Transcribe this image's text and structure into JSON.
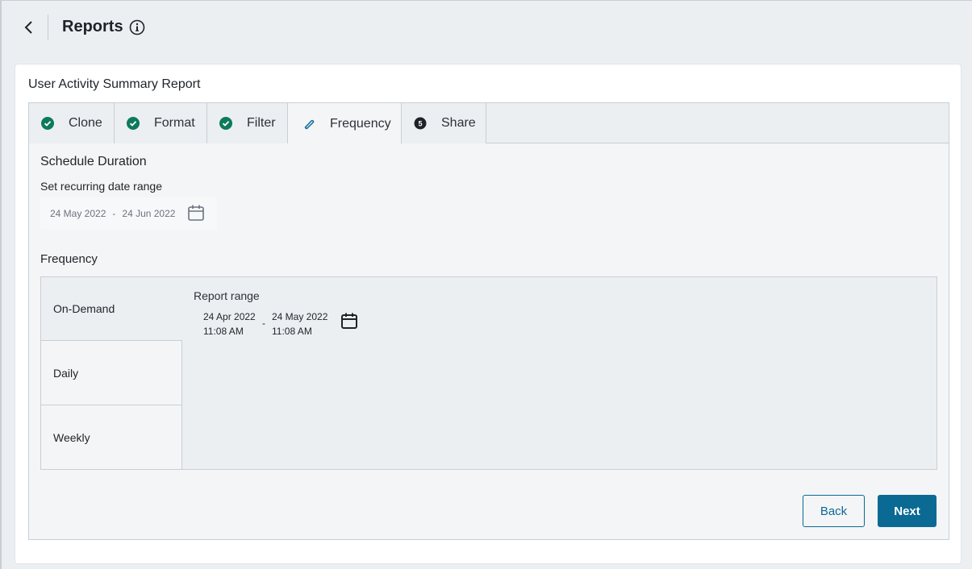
{
  "header": {
    "title": "Reports",
    "back_icon": "chevron-left-icon",
    "info_icon": "info-circle-icon"
  },
  "card": {
    "title": "User Activity Summary Report"
  },
  "tabs": [
    {
      "label": "Clone",
      "status": "complete",
      "icon": "check-circle-icon"
    },
    {
      "label": "Format",
      "status": "complete",
      "icon": "check-circle-icon"
    },
    {
      "label": "Filter",
      "status": "complete",
      "icon": "check-circle-icon"
    },
    {
      "label": "Frequency",
      "status": "active",
      "icon": "pencil-icon"
    },
    {
      "label": "Share",
      "status": "pending",
      "icon": "step-number-icon",
      "step": "5"
    }
  ],
  "schedule": {
    "title": "Schedule Duration",
    "date_range_label": "Set recurring date range",
    "start_date": "24 May 2022",
    "separator": "-",
    "end_date": "24 Jun 2022"
  },
  "frequency": {
    "title": "Frequency",
    "options": [
      "On-Demand",
      "Daily",
      "Weekly"
    ],
    "selected": "On-Demand",
    "report_range": {
      "label": "Report range",
      "from_date": "24 Apr 2022",
      "from_time": "11:08 AM",
      "separator": "-",
      "to_date": "24 May 2022",
      "to_time": "11:08 AM"
    }
  },
  "actions": {
    "back_label": "Back",
    "next_label": "Next"
  },
  "colors": {
    "primary": "#0a6a94",
    "success": "#0e7a5c",
    "background": "#eceff2"
  }
}
